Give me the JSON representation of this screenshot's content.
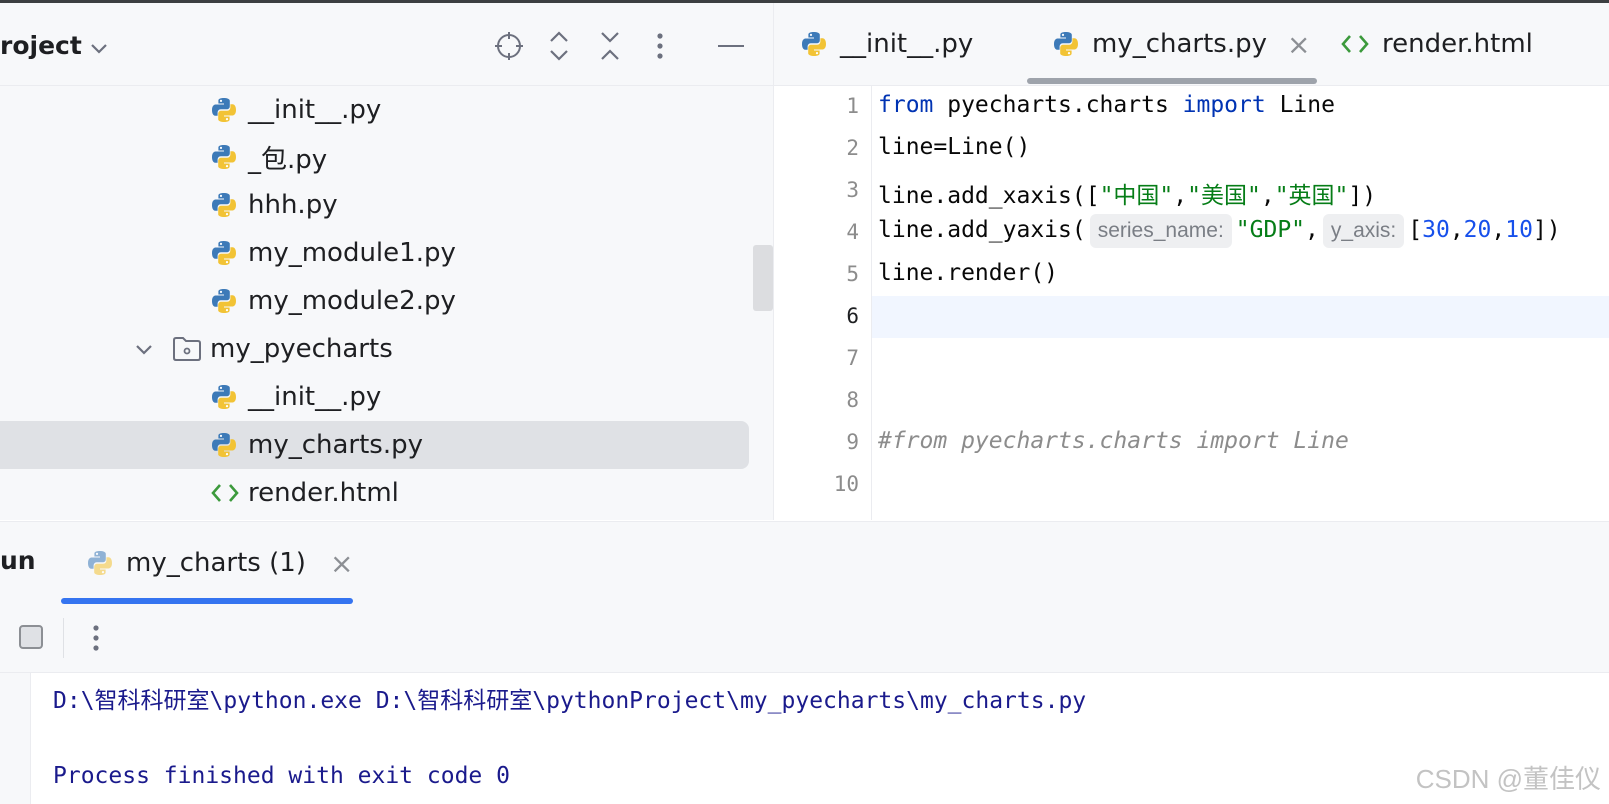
{
  "project": {
    "title": "roject",
    "header_icons": [
      "locate-icon",
      "expand-all-icon",
      "collapse-all-icon",
      "more-vert-icon",
      "minimize-icon"
    ],
    "tree": [
      {
        "label": "__init__.py",
        "type": "python"
      },
      {
        "label": "_包.py",
        "type": "python"
      },
      {
        "label": "hhh.py",
        "type": "python"
      },
      {
        "label": "my_module1.py",
        "type": "python"
      },
      {
        "label": "my_module2.py",
        "type": "python"
      },
      {
        "label": "my_pyecharts",
        "type": "folder"
      },
      {
        "label": "__init__.py",
        "type": "python"
      },
      {
        "label": "my_charts.py",
        "type": "python",
        "selected": true
      },
      {
        "label": "render.html",
        "type": "html"
      }
    ]
  },
  "editor": {
    "tabs": [
      {
        "label": "__init__.py",
        "type": "python"
      },
      {
        "label": "my_charts.py",
        "type": "python",
        "active": true,
        "close": "×"
      },
      {
        "label": "render.html",
        "type": "html"
      }
    ],
    "line_numbers": [
      "1",
      "2",
      "3",
      "4",
      "5",
      "6",
      "7",
      "8",
      "9",
      "10"
    ],
    "current_line": "6",
    "code": {
      "l1_kw1": "from",
      "l1_mod": " pyecharts.charts ",
      "l1_kw2": "import",
      "l1_cls": " Line",
      "l2": "line=Line()",
      "l3_a": "line.add_xaxis([",
      "l3_s1": "\"中国\"",
      "l3_c1": ",",
      "l3_s2": "\"美国\"",
      "l3_c2": ",",
      "l3_s3": "\"英国\"",
      "l3_b": "])",
      "l4_a": "line.add_yaxis(",
      "l4_hint1": "series_name:",
      "l4_s": "\"GDP\"",
      "l4_c": ",",
      "l4_hint2": "y_axis:",
      "l4_o": "[",
      "l4_n1": "30",
      "l4_c1": ",",
      "l4_n2": "20",
      "l4_c2": ",",
      "l4_n3": "10",
      "l4_e": "])",
      "l5": "line.render()",
      "l9": "#from pyecharts.charts import Line"
    }
  },
  "run": {
    "title": "un",
    "tab_label": "my_charts (1)",
    "tab_close": "×",
    "console": [
      "D:\\智科科研室\\python.exe D:\\智科科研室\\pythonProject\\my_pyecharts\\my_charts.py",
      "",
      "Process finished with exit code 0"
    ]
  },
  "watermark": "CSDN @董佳仪",
  "colors": {
    "keyword": "#0033b3",
    "string": "#067d17",
    "number": "#1750eb",
    "comment": "#8c8c8c",
    "console_text": "#1a1a8c",
    "tab_accent": "#3574f0"
  }
}
